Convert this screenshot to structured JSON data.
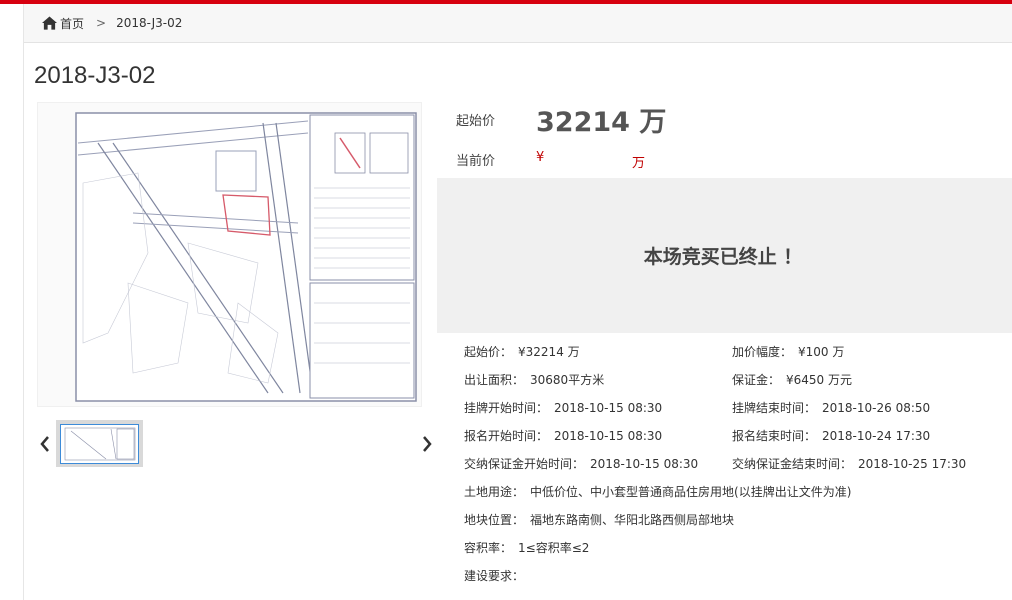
{
  "breadcrumb": {
    "home": "首页",
    "separator": ">",
    "current": "2018-J3-02"
  },
  "title": "2018-J3-02",
  "price": {
    "start_label": "起始价",
    "start_value": "32214 万",
    "current_label": "当前价",
    "current_yen": "¥",
    "current_unit": "万"
  },
  "status": "本场竞买已终止 ！",
  "details": [
    {
      "label": "起始价：",
      "value": "¥32214 万"
    },
    {
      "label": "加价幅度：",
      "value": "¥100 万"
    },
    {
      "label": "出让面积：",
      "value": "30680平方米"
    },
    {
      "label": "保证金：",
      "value": "¥6450 万元"
    },
    {
      "label": "挂牌开始时间：",
      "value": "2018-10-15 08:30"
    },
    {
      "label": "挂牌结束时间：",
      "value": "2018-10-26 08:50"
    },
    {
      "label": "报名开始时间：",
      "value": "2018-10-15 08:30"
    },
    {
      "label": "报名结束时间：",
      "value": "2018-10-24 17:30"
    },
    {
      "label": "交纳保证金开始时间：",
      "value": "2018-10-15 08:30"
    },
    {
      "label": "交纳保证金结束时间：",
      "value": "2018-10-25 17:30"
    },
    {
      "label": "土地用途：",
      "value": "中低价位、中小套型普通商品住房用地(以挂牌出让文件为准)"
    },
    {
      "label": "地块位置：",
      "value": "福地东路南侧、华阳北路西侧局部地块"
    },
    {
      "label": "容积率：",
      "value": "1≤容积率≤2"
    },
    {
      "label": "建设要求：",
      "value": ""
    }
  ],
  "colors": {
    "accent": "#d7000f",
    "price_red": "#c00000",
    "status_bg": "#f0f0f0"
  },
  "icons": {
    "home": "home-icon",
    "prev": "chevron-left-icon",
    "next": "chevron-right-icon"
  }
}
